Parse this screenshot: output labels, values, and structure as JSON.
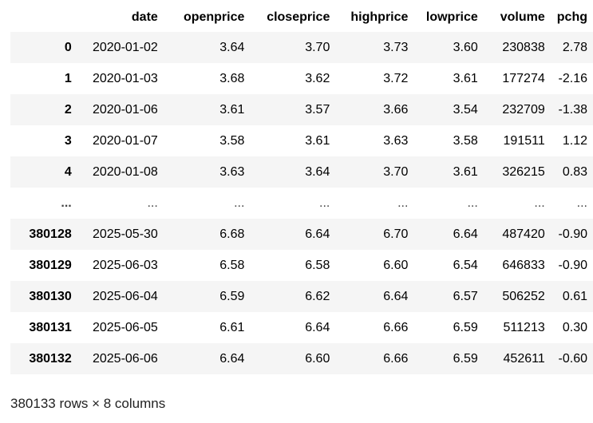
{
  "columns": [
    "date",
    "openprice",
    "closeprice",
    "highprice",
    "lowprice",
    "volume",
    "pchg"
  ],
  "rows": [
    {
      "index": "0",
      "cells": [
        "2020-01-02",
        "3.64",
        "3.70",
        "3.73",
        "3.60",
        "230838",
        "2.78"
      ]
    },
    {
      "index": "1",
      "cells": [
        "2020-01-03",
        "3.68",
        "3.62",
        "3.72",
        "3.61",
        "177274",
        "-2.16"
      ]
    },
    {
      "index": "2",
      "cells": [
        "2020-01-06",
        "3.61",
        "3.57",
        "3.66",
        "3.54",
        "232709",
        "-1.38"
      ]
    },
    {
      "index": "3",
      "cells": [
        "2020-01-07",
        "3.58",
        "3.61",
        "3.63",
        "3.58",
        "191511",
        "1.12"
      ]
    },
    {
      "index": "4",
      "cells": [
        "2020-01-08",
        "3.63",
        "3.64",
        "3.70",
        "3.61",
        "326215",
        "0.83"
      ]
    },
    {
      "index": "...",
      "cells": [
        "...",
        "...",
        "...",
        "...",
        "...",
        "...",
        "..."
      ]
    },
    {
      "index": "380128",
      "cells": [
        "2025-05-30",
        "6.68",
        "6.64",
        "6.70",
        "6.64",
        "487420",
        "-0.90"
      ]
    },
    {
      "index": "380129",
      "cells": [
        "2025-06-03",
        "6.58",
        "6.58",
        "6.60",
        "6.54",
        "646833",
        "-0.90"
      ]
    },
    {
      "index": "380130",
      "cells": [
        "2025-06-04",
        "6.59",
        "6.62",
        "6.64",
        "6.57",
        "506252",
        "0.61"
      ]
    },
    {
      "index": "380131",
      "cells": [
        "2025-06-05",
        "6.61",
        "6.64",
        "6.66",
        "6.59",
        "511213",
        "0.30"
      ]
    },
    {
      "index": "380132",
      "cells": [
        "2025-06-06",
        "6.64",
        "6.60",
        "6.66",
        "6.59",
        "452611",
        "-0.60"
      ]
    }
  ],
  "shape_text": "380133 rows × 8 columns"
}
